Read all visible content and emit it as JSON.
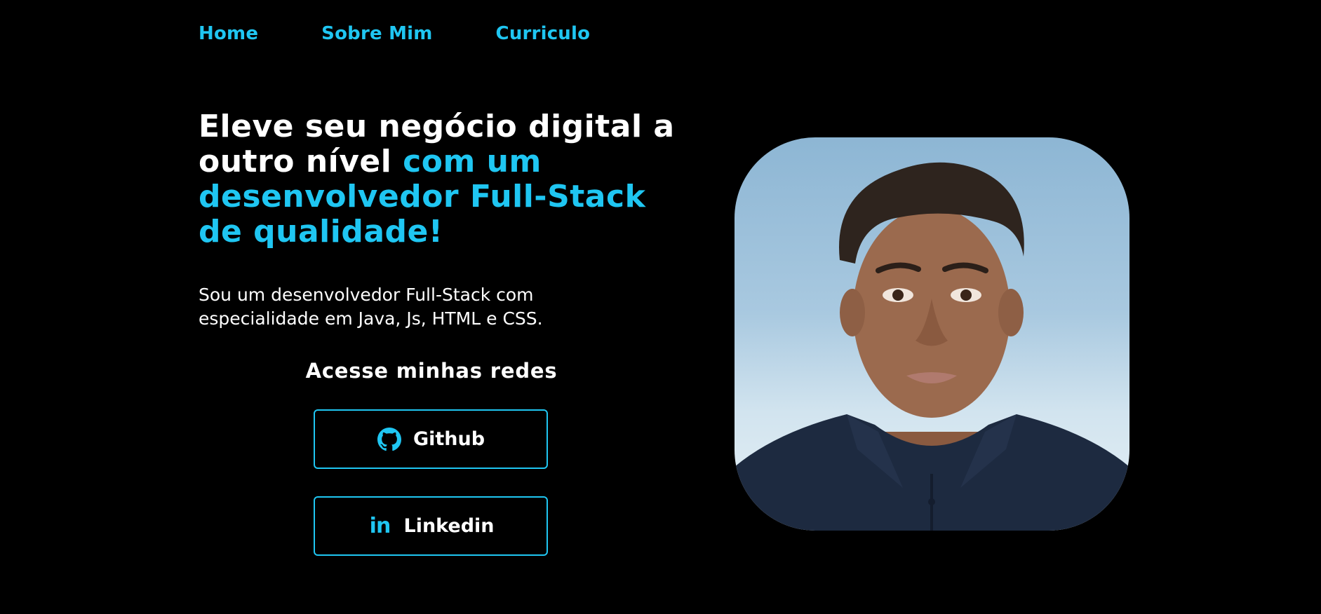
{
  "nav": {
    "items": [
      "Home",
      "Sobre Mim",
      "Curriculo"
    ]
  },
  "hero": {
    "title_white": "Eleve seu negócio digital a outro nível",
    "title_accent": "com um desenvolvedor Full-Stack de qualidade!",
    "description": "Sou um desenvolvedor Full-Stack com especialidade em Java, Js, HTML e CSS."
  },
  "social": {
    "heading": "Acesse minhas redes",
    "github_label": "Github",
    "linkedin_label": "Linkedin",
    "linkedin_icon_text": "in"
  },
  "icons": {
    "github": "github-icon",
    "linkedin": "linkedin-icon"
  },
  "colors": {
    "background": "#000000",
    "accent": "#1fc6f2",
    "text": "#ffffff"
  }
}
